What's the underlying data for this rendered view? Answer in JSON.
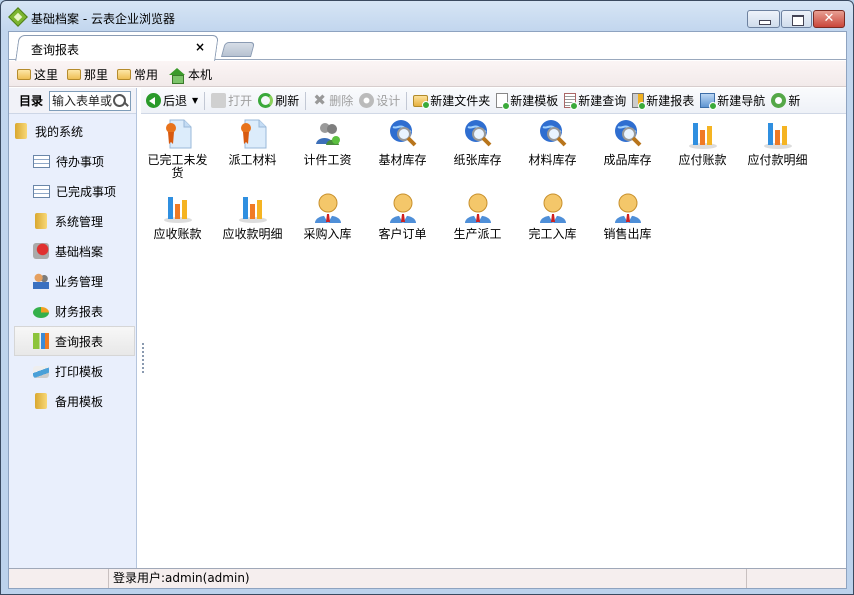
{
  "window": {
    "title": "基础档案 - 云表企业浏览器",
    "close_glyph": "✕"
  },
  "tabs": [
    {
      "label": "查询报表",
      "close": "×"
    }
  ],
  "quickbar": [
    {
      "label": "这里",
      "icon": "folder-icon"
    },
    {
      "label": "那里",
      "icon": "folder-icon"
    },
    {
      "label": "常用",
      "icon": "folder-icon"
    },
    {
      "label": "本机",
      "icon": "home-icon"
    }
  ],
  "sidebar": {
    "heading": "目录",
    "search_placeholder": "输入表单或",
    "items": [
      {
        "label": "我的系统",
        "icon": "folder",
        "level": "root"
      },
      {
        "label": "待办事项",
        "icon": "grid",
        "level": "child"
      },
      {
        "label": "已完成事项",
        "icon": "grid",
        "level": "child"
      },
      {
        "label": "系统管理",
        "icon": "folder",
        "level": "child"
      },
      {
        "label": "基础档案",
        "icon": "red",
        "level": "child"
      },
      {
        "label": "业务管理",
        "icon": "users",
        "level": "child"
      },
      {
        "label": "财务报表",
        "icon": "pie",
        "level": "child"
      },
      {
        "label": "查询报表",
        "icon": "bars",
        "level": "child",
        "selected": true
      },
      {
        "label": "打印模板",
        "icon": "print",
        "level": "child"
      },
      {
        "label": "备用模板",
        "icon": "folder",
        "level": "child"
      }
    ]
  },
  "toolbar": [
    {
      "label": "后退",
      "icon": "back",
      "dropdown": true
    },
    {
      "sep": true
    },
    {
      "label": "打开",
      "icon": "gray",
      "disabled": true
    },
    {
      "label": "刷新",
      "icon": "refresh"
    },
    {
      "sep": true
    },
    {
      "label": "删除",
      "icon": "x",
      "disabled": true
    },
    {
      "label": "设计",
      "icon": "gear",
      "disabled": true
    },
    {
      "sep": true
    },
    {
      "label": "新建文件夹",
      "icon": "newfolder",
      "plus": true
    },
    {
      "label": "新建模板",
      "icon": "doc",
      "plus": true
    },
    {
      "label": "新建查询",
      "icon": "ledger",
      "plus": true
    },
    {
      "label": "新建报表",
      "icon": "report",
      "plus": true
    },
    {
      "label": "新建导航",
      "icon": "nav",
      "plus": true
    },
    {
      "label": "新",
      "icon": "globe"
    }
  ],
  "items": [
    {
      "label": "已完工未发货",
      "icon": "ribbon-doc"
    },
    {
      "label": "派工材料",
      "icon": "ribbon-doc"
    },
    {
      "label": "计件工资",
      "icon": "users"
    },
    {
      "label": "基材库存",
      "icon": "globe-search"
    },
    {
      "label": "纸张库存",
      "icon": "globe-search"
    },
    {
      "label": "材料库存",
      "icon": "globe-search"
    },
    {
      "label": "成品库存",
      "icon": "globe-search"
    },
    {
      "label": "应付账款",
      "icon": "bar-chart"
    },
    {
      "label": "应付款明细",
      "icon": "bar-chart"
    },
    {
      "label": "应收账款",
      "icon": "bar-chart"
    },
    {
      "label": "应收款明细",
      "icon": "bar-chart"
    },
    {
      "label": "采购入库",
      "icon": "person"
    },
    {
      "label": "客户订单",
      "icon": "person"
    },
    {
      "label": "生产派工",
      "icon": "person"
    },
    {
      "label": "完工入库",
      "icon": "person"
    },
    {
      "label": "销售出库",
      "icon": "person"
    }
  ],
  "status": {
    "user": "登录用户:admin(admin)"
  }
}
